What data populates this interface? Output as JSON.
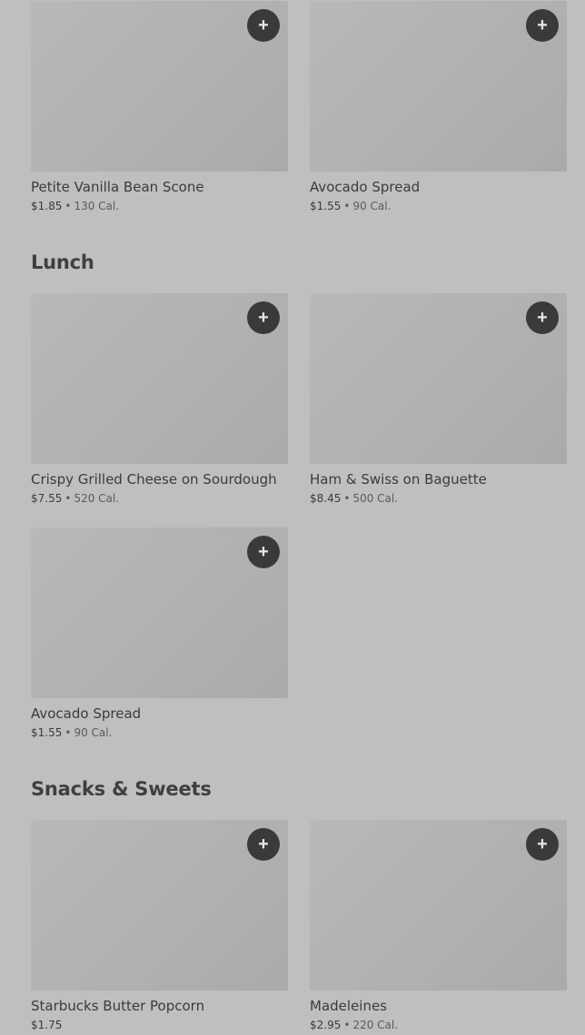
{
  "sections": {
    "top": {
      "items": [
        {
          "name": "Petite Vanilla Bean Scone",
          "price": "$1.85",
          "calories": "130 Cal."
        },
        {
          "name": "Avocado Spread",
          "price": "$1.55",
          "calories": "90 Cal."
        }
      ]
    },
    "lunch": {
      "title": "Lunch",
      "items": [
        {
          "name": "Crispy Grilled Cheese on Sourdough",
          "price": "$7.55",
          "calories": "520 Cal."
        },
        {
          "name": "Ham & Swiss on Baguette",
          "price": "$8.45",
          "calories": "500 Cal."
        },
        {
          "name": "Avocado Spread",
          "price": "$1.55",
          "calories": "90 Cal."
        }
      ]
    },
    "snacks": {
      "title": "Snacks & Sweets",
      "items": [
        {
          "name": "Starbucks Butter Popcorn",
          "price": "$1.75"
        },
        {
          "name": "Madeleines",
          "price": "$2.95",
          "calories": "220 Cal."
        }
      ]
    }
  },
  "separator": "•",
  "add_symbol": "+"
}
